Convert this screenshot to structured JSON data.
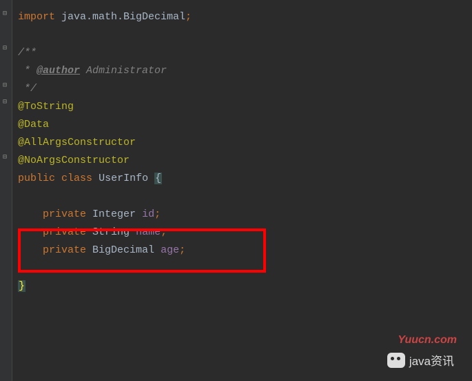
{
  "code": {
    "import_kw": "import",
    "import_pkg": " java.math.BigDecimal",
    "semicolon": ";",
    "doc_open": "/**",
    "doc_star": " * ",
    "doc_tag": "@author",
    "doc_author": " Administrator",
    "doc_close": " */",
    "anno_tostring": "@ToString",
    "anno_data": "@Data",
    "anno_allargs": "@AllArgsConstructor",
    "anno_noargs": "@NoArgsConstructor",
    "public_kw": "public",
    "class_kw": "class",
    "class_name": "UserInfo",
    "brace_open": "{",
    "brace_close": "}",
    "private_kw": "private",
    "type_integer": "Integer",
    "type_string": "String",
    "type_bigdecimal": "BigDecimal",
    "field_id": "id",
    "field_name": "name",
    "field_age": "age"
  },
  "watermark": {
    "site": "Yuucn.com",
    "channel": "java资讯"
  }
}
